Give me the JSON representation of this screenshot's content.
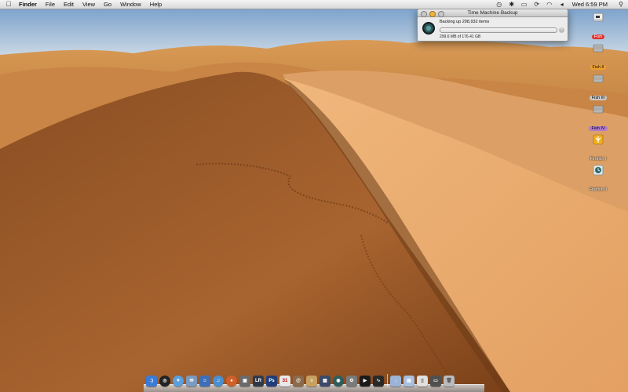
{
  "menubar": {
    "app_name": "Finder",
    "items": [
      "File",
      "Edit",
      "View",
      "Go",
      "Window",
      "Help"
    ],
    "clock": "Wed 6:59 PM"
  },
  "time_machine": {
    "title": "Time Machine Backup",
    "status": "Backing up 298,932 items",
    "size_text": "299.6 MB of 176.41 GB",
    "progress_percent": 0.3
  },
  "desktop": {
    "drives": [
      {
        "label": "Fish",
        "label_color": "#e0302a"
      },
      {
        "label": "Fish II",
        "label_color": "#f0a030"
      },
      {
        "label": "Fish III",
        "label_color": "#c0c0c0"
      },
      {
        "label": "Fish IV",
        "label_color": "#b07ad0"
      },
      {
        "label": "Firefish I",
        "label_color": ""
      },
      {
        "label": "Firefish II",
        "label_color": ""
      }
    ]
  },
  "dock": {
    "apps": [
      {
        "name": "finder-icon",
        "color": "#3a7bd5",
        "glyph": ":)"
      },
      {
        "name": "dashboard-icon",
        "color": "#222222",
        "glyph": "◎"
      },
      {
        "name": "safari-icon",
        "color": "#5aa0e0",
        "glyph": "✦"
      },
      {
        "name": "mail-icon",
        "color": "#7a9ac0",
        "glyph": "✉"
      },
      {
        "name": "ichat-icon",
        "color": "#3d6fb8",
        "glyph": "☺"
      },
      {
        "name": "itunes-icon",
        "color": "#4a90d0",
        "glyph": "♫"
      },
      {
        "name": "firefox-icon",
        "color": "#d0602a",
        "glyph": "●"
      },
      {
        "name": "preview-icon",
        "color": "#6a6a6a",
        "glyph": "▣"
      },
      {
        "name": "lightroom-icon",
        "color": "#2e3a4a",
        "glyph": "LR"
      },
      {
        "name": "photoshop-icon",
        "color": "#1f3e7a",
        "glyph": "Ps"
      },
      {
        "name": "ical-icon",
        "color": "#e8e8e8",
        "glyph": "31"
      },
      {
        "name": "address-book-icon",
        "color": "#8a6a4a",
        "glyph": "@"
      },
      {
        "name": "notes-icon",
        "color": "#c8a060",
        "glyph": "≡"
      },
      {
        "name": "spaces-icon",
        "color": "#3a4a6a",
        "glyph": "▦"
      },
      {
        "name": "time-machine-icon",
        "color": "#2f5d5d",
        "glyph": "◉"
      },
      {
        "name": "system-preferences-icon",
        "color": "#7a7a7a",
        "glyph": "⚙"
      },
      {
        "name": "terminal-icon",
        "color": "#1a1a1a",
        "glyph": "▶"
      },
      {
        "name": "activity-monitor-icon",
        "color": "#2a2a2a",
        "glyph": "∿"
      },
      {
        "name": "downloads-folder-icon",
        "color": "#9cb4d8",
        "glyph": "↓"
      },
      {
        "name": "documents-folder-icon",
        "color": "#a8c0e0",
        "glyph": "▤"
      },
      {
        "name": "file-icon",
        "color": "#e0e0e0",
        "glyph": "▯"
      },
      {
        "name": "display-icon",
        "color": "#505050",
        "glyph": "▭"
      },
      {
        "name": "trash-icon",
        "color": "#b8bcc0",
        "glyph": "🗑"
      }
    ]
  }
}
